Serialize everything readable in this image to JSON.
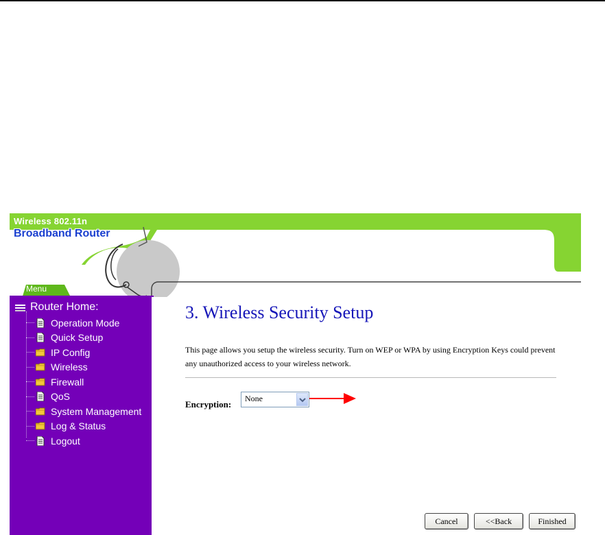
{
  "header": {
    "brand_line1": "Wireless 802.11n",
    "brand_line2": "Broadband Router",
    "menu_tab": "Menu"
  },
  "sidebar": {
    "home_label": "Router Home:",
    "items": [
      {
        "label": "Operation Mode",
        "icon": "page-icon"
      },
      {
        "label": "Quick Setup",
        "icon": "page-icon"
      },
      {
        "label": "IP Config",
        "icon": "folder-icon"
      },
      {
        "label": "Wireless",
        "icon": "folder-icon"
      },
      {
        "label": "Firewall",
        "icon": "folder-icon"
      },
      {
        "label": "QoS",
        "icon": "page-icon"
      },
      {
        "label": "System Management",
        "icon": "folder-icon"
      },
      {
        "label": "Log & Status",
        "icon": "folder-icon"
      },
      {
        "label": "Logout",
        "icon": "page-icon"
      }
    ]
  },
  "main": {
    "title": "3. Wireless Security Setup",
    "description": "This page allows you setup the wireless security. Turn on WEP or WPA by using Encryption Keys could prevent any unauthorized access to your wireless network.",
    "encryption_label": "Encryption:",
    "encryption_value": "None"
  },
  "buttons": {
    "cancel": "Cancel",
    "back": "<<Back",
    "finished": "Finished"
  },
  "colors": {
    "sidebar_bg": "#7400b8",
    "header_green": "#7ed321",
    "title_blue": "#1616b8",
    "annotation_arrow": "#ff0000"
  }
}
